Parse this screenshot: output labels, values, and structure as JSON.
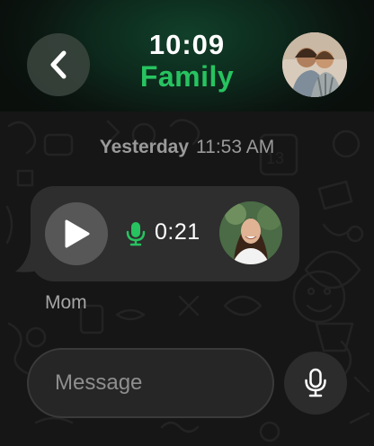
{
  "status": {
    "time": "10:09"
  },
  "chat": {
    "title": "Family",
    "accent_color": "#27c360"
  },
  "messages": {
    "date_day": "Yesterday",
    "date_time": "11:53 AM",
    "voice_message": {
      "duration": "0:21",
      "sender": "Mom"
    }
  },
  "composer": {
    "placeholder": "Message"
  },
  "icons": {
    "back": "chevron-left-icon",
    "play": "play-icon",
    "mic": "microphone-icon"
  }
}
